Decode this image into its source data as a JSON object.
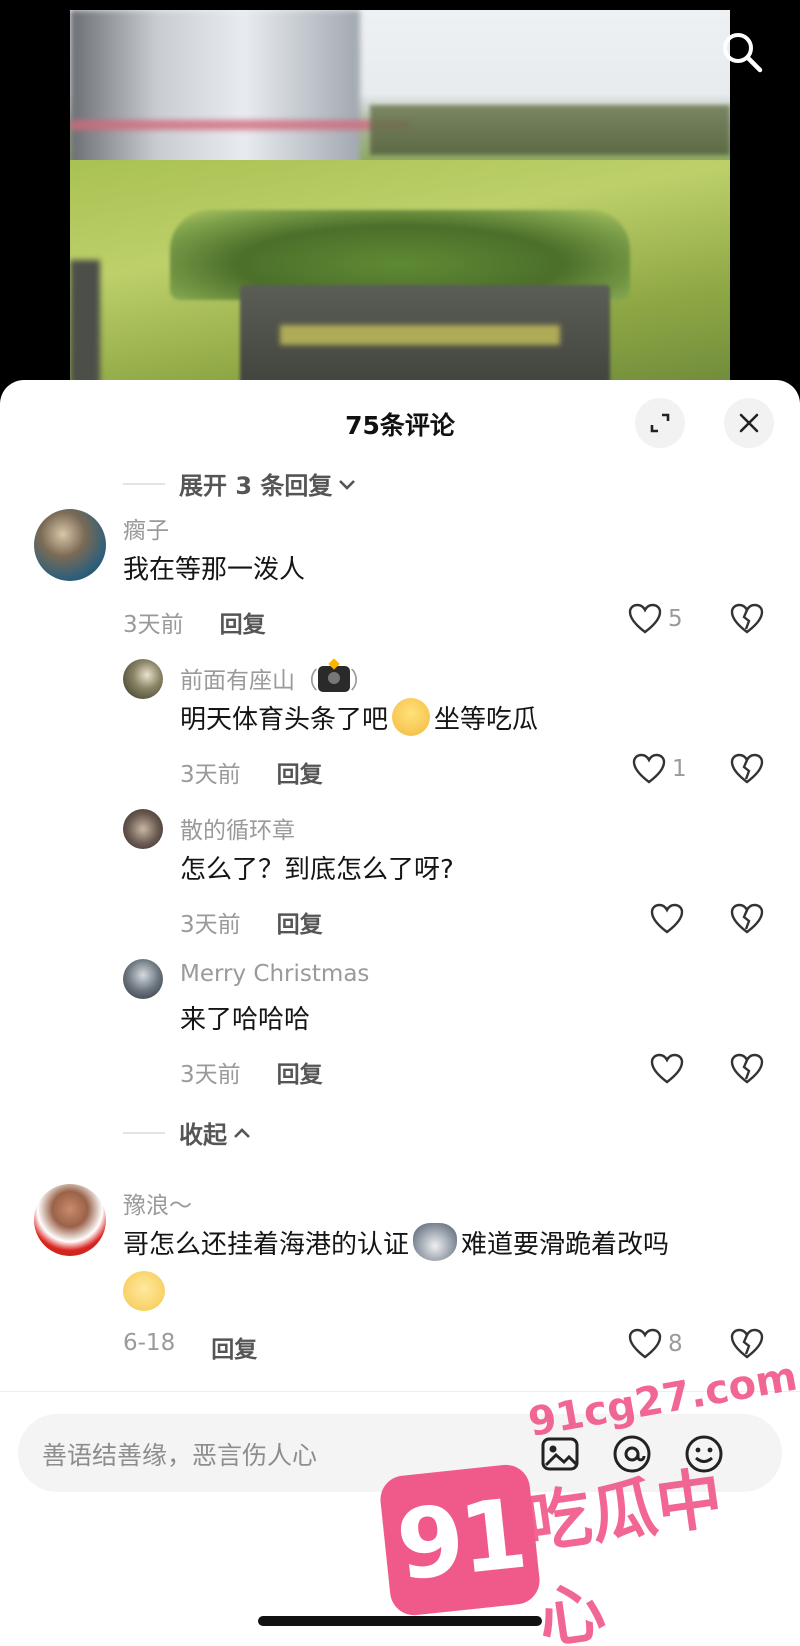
{
  "sheet": {
    "title": "75条评论",
    "expand_replies": "展开 3 条回复",
    "collapse": "收起"
  },
  "comments": [
    {
      "name": "瘸子",
      "text": "我在等那一泼人",
      "time": "3天前",
      "reply": "回复",
      "likes": "5"
    },
    {
      "name": "前面有座山（",
      "name_suffix": "）",
      "text_before": "明天体育头条了吧",
      "text_after": "坐等吃瓜",
      "time": "3天前",
      "reply": "回复",
      "likes": "1"
    },
    {
      "name": "散的循环章",
      "text": "怎么了？到底怎么了呀?",
      "time": "3天前",
      "reply": "回复"
    },
    {
      "name": "Merry Christmas",
      "text": "来了哈哈哈",
      "time": "3天前",
      "reply": "回复"
    },
    {
      "name": "豫浪～",
      "text_before": "哥怎么还挂着海港的认证",
      "text_after": "难道要滑跪着改吗",
      "time": "6-18",
      "reply": "回复",
      "likes": "8"
    }
  ],
  "input": {
    "placeholder": "善语结善缘，恶言伤人心"
  },
  "watermark": {
    "badge": "91",
    "url": "91cg27.com",
    "text": "吃瓜中心"
  },
  "icons": [
    "search-icon",
    "expand-icon",
    "close-icon",
    "chevron-down-icon",
    "chevron-up-icon",
    "heart-icon",
    "broken-heart-icon",
    "image-icon",
    "at-icon",
    "emoji-icon",
    "camera-icon"
  ],
  "colors": {
    "watermark_pink": "#f05a8a",
    "muted_text": "#9a9a9a"
  }
}
